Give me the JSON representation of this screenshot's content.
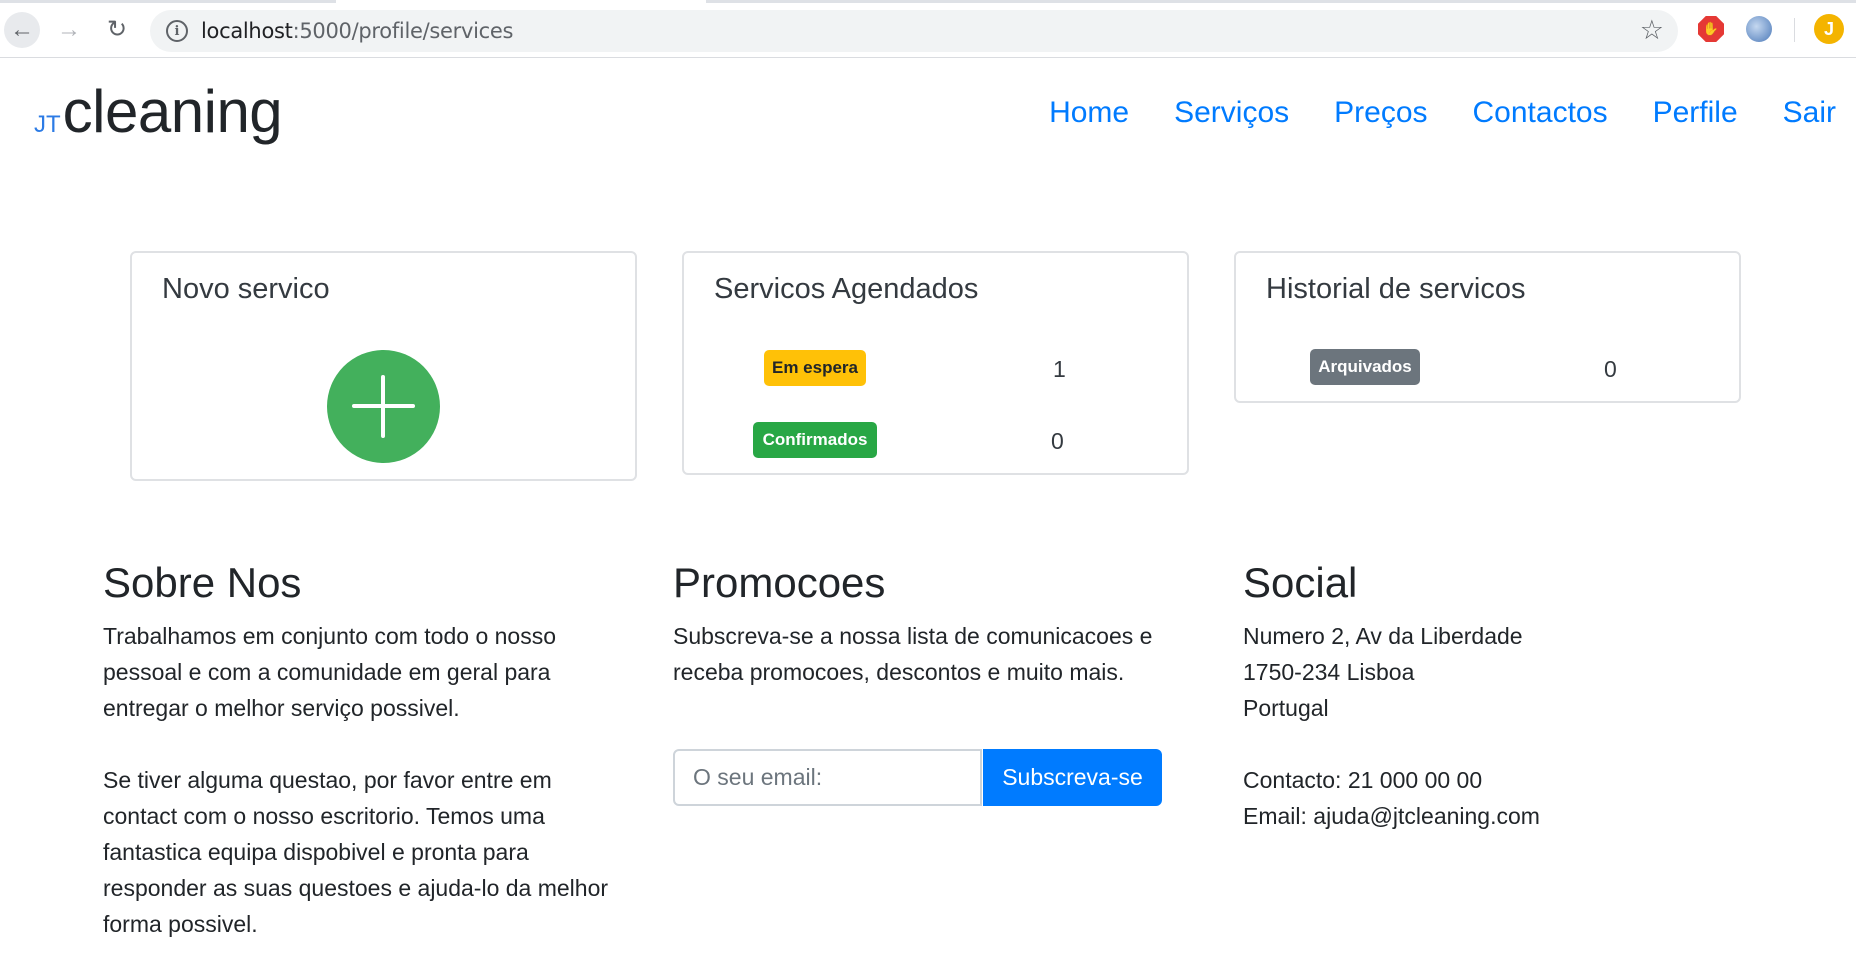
{
  "browser": {
    "url_host": "localhost",
    "url_rest": ":5000/profile/services",
    "avatar_letter": "J",
    "accent": "#007bff"
  },
  "brand": {
    "prefix": "JT",
    "name": "cleaning"
  },
  "nav": [
    {
      "label": "Home"
    },
    {
      "label": "Serviços"
    },
    {
      "label": "Preços"
    },
    {
      "label": "Contactos"
    },
    {
      "label": "Perfile"
    },
    {
      "label": "Sair"
    }
  ],
  "cards": {
    "novo": {
      "title": "Novo servico",
      "icon": "plus-icon"
    },
    "agendados": {
      "title": "Servicos Agendados",
      "items": [
        {
          "badge": "Em espera",
          "count": "1",
          "color": "#ffc107"
        },
        {
          "badge": "Confirmados",
          "count": "0",
          "color": "#28a745"
        }
      ]
    },
    "historial": {
      "title": "Historial de servicos",
      "items": [
        {
          "badge": "Arquivados",
          "count": "0",
          "color": "#6c757d"
        }
      ]
    }
  },
  "footer": {
    "sobre": {
      "title": "Sobre Nos",
      "p1_lines": [
        "Trabalhamos em conjunto com todo o nosso",
        "pessoal e com a comunidade em geral para",
        "entregar o melhor serviço possivel."
      ],
      "p2_lines": [
        "Se tiver alguma questao, por favor entre em",
        "contact com o nosso escritorio. Temos uma",
        "fantastica equipa dispobivel e pronta para",
        "responder as suas questoes e ajuda-lo da melhor",
        "forma possivel."
      ]
    },
    "promocoes": {
      "title": "Promocoes",
      "lines": [
        "Subscreva-se a nossa lista de comunicacoes e",
        "receba promocoes, descontos e muito mais."
      ],
      "email_placeholder": "O seu email:",
      "button": "Subscreva-se"
    },
    "social": {
      "title": "Social",
      "address_lines": [
        "Numero 2, Av da Liberdade",
        "1750-234 Lisboa",
        "Portugal"
      ],
      "contact": "Contacto: 21 000 00 00",
      "email": "Email: ajuda@jtcleaning.com"
    }
  }
}
